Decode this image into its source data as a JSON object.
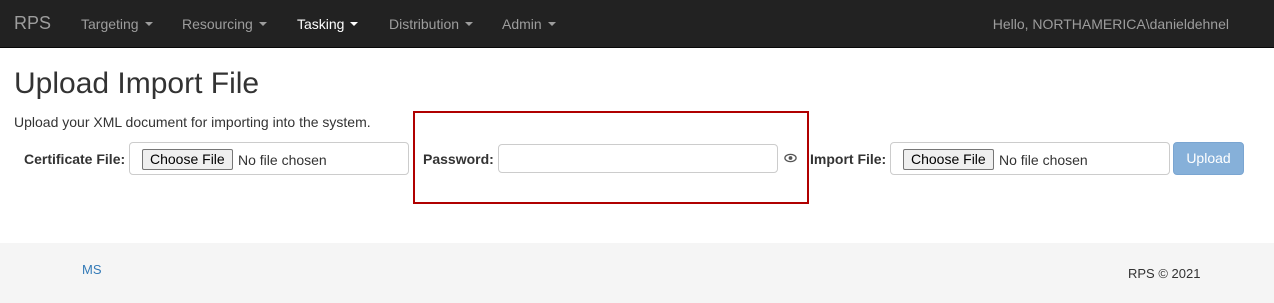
{
  "navbar": {
    "brand": "RPS",
    "items": [
      {
        "label": "Targeting",
        "active": false
      },
      {
        "label": "Resourcing",
        "active": false
      },
      {
        "label": "Tasking",
        "active": true
      },
      {
        "label": "Distribution",
        "active": false
      },
      {
        "label": "Admin",
        "active": false
      }
    ],
    "greeting": "Hello, NORTHAMERICA\\danieldehnel"
  },
  "page": {
    "title": "Upload Import File",
    "description": "Upload your XML document for importing into the system."
  },
  "form": {
    "certificate": {
      "label": "Certificate File:",
      "button": "Choose File",
      "status": "No file chosen"
    },
    "password": {
      "label": "Password:",
      "value": "",
      "icon": "eye-icon"
    },
    "import_file": {
      "label": "Import File:",
      "button": "Choose File",
      "status": "No file chosen"
    },
    "upload_label": "Upload"
  },
  "footer": {
    "link": "MS",
    "copyright": "RPS © 2021"
  },
  "colors": {
    "navbar_bg": "#222222",
    "nav_text": "#9d9d9d",
    "nav_active": "#ffffff",
    "highlight": "#b00000",
    "upload_button": "#86b0d9",
    "link": "#337ab7",
    "footer_bg": "#f5f5f5"
  }
}
